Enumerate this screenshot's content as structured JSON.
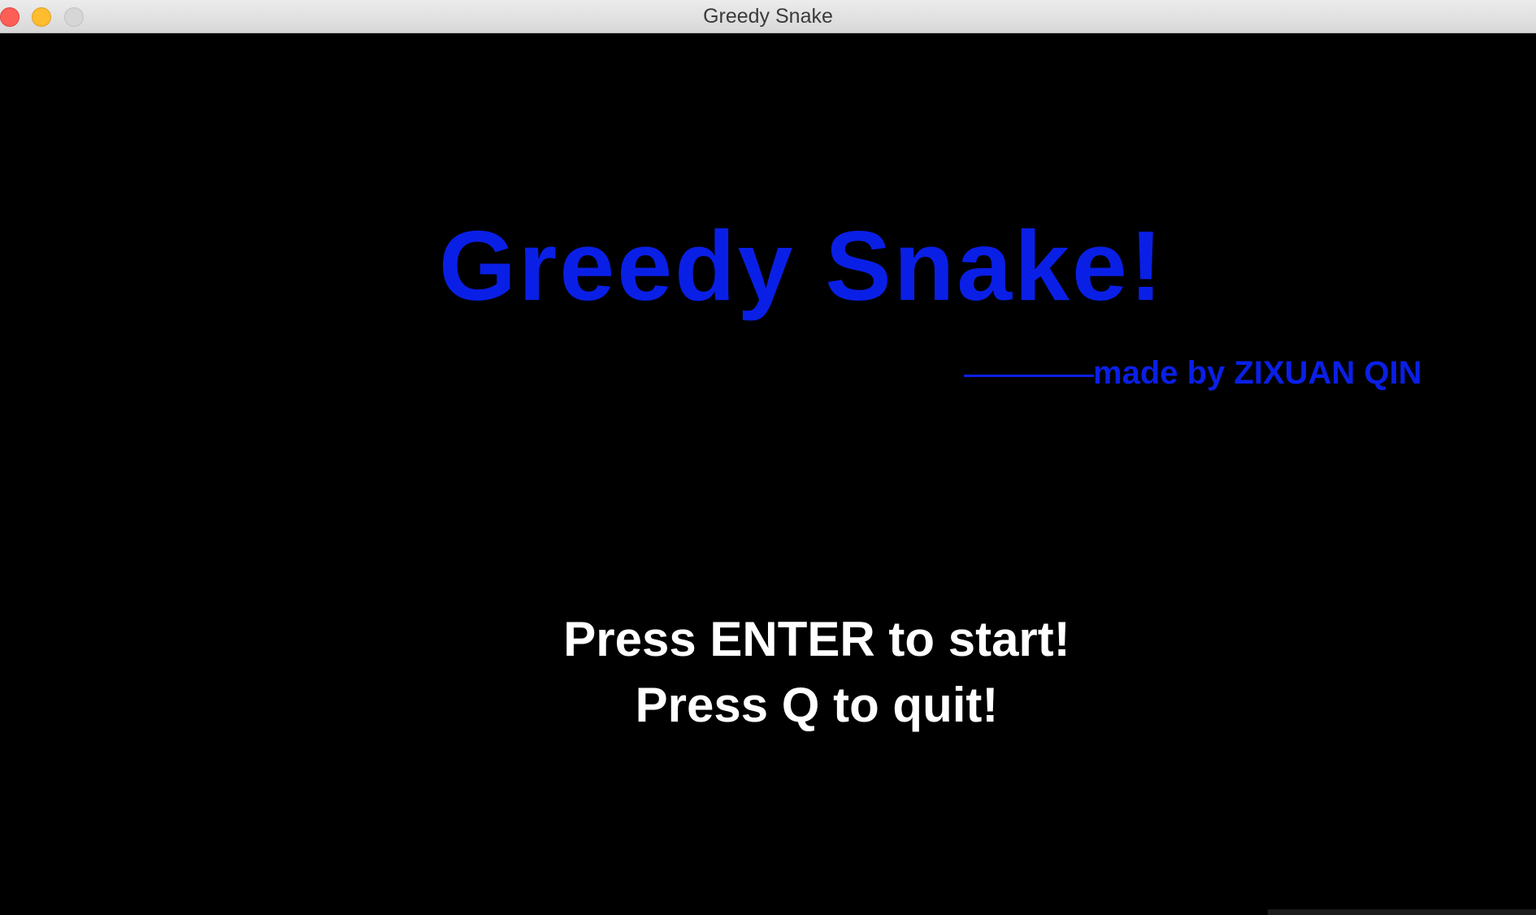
{
  "window": {
    "title": "Greedy Snake"
  },
  "game": {
    "title": "Greedy Snake!",
    "credit": "made by ZIXUAN QIN",
    "start_prompt": "Press ENTER to start!",
    "quit_prompt": "Press Q to quit!"
  },
  "colors": {
    "background": "#000000",
    "title": "#0a1fe6",
    "prompt": "#ffffff"
  }
}
